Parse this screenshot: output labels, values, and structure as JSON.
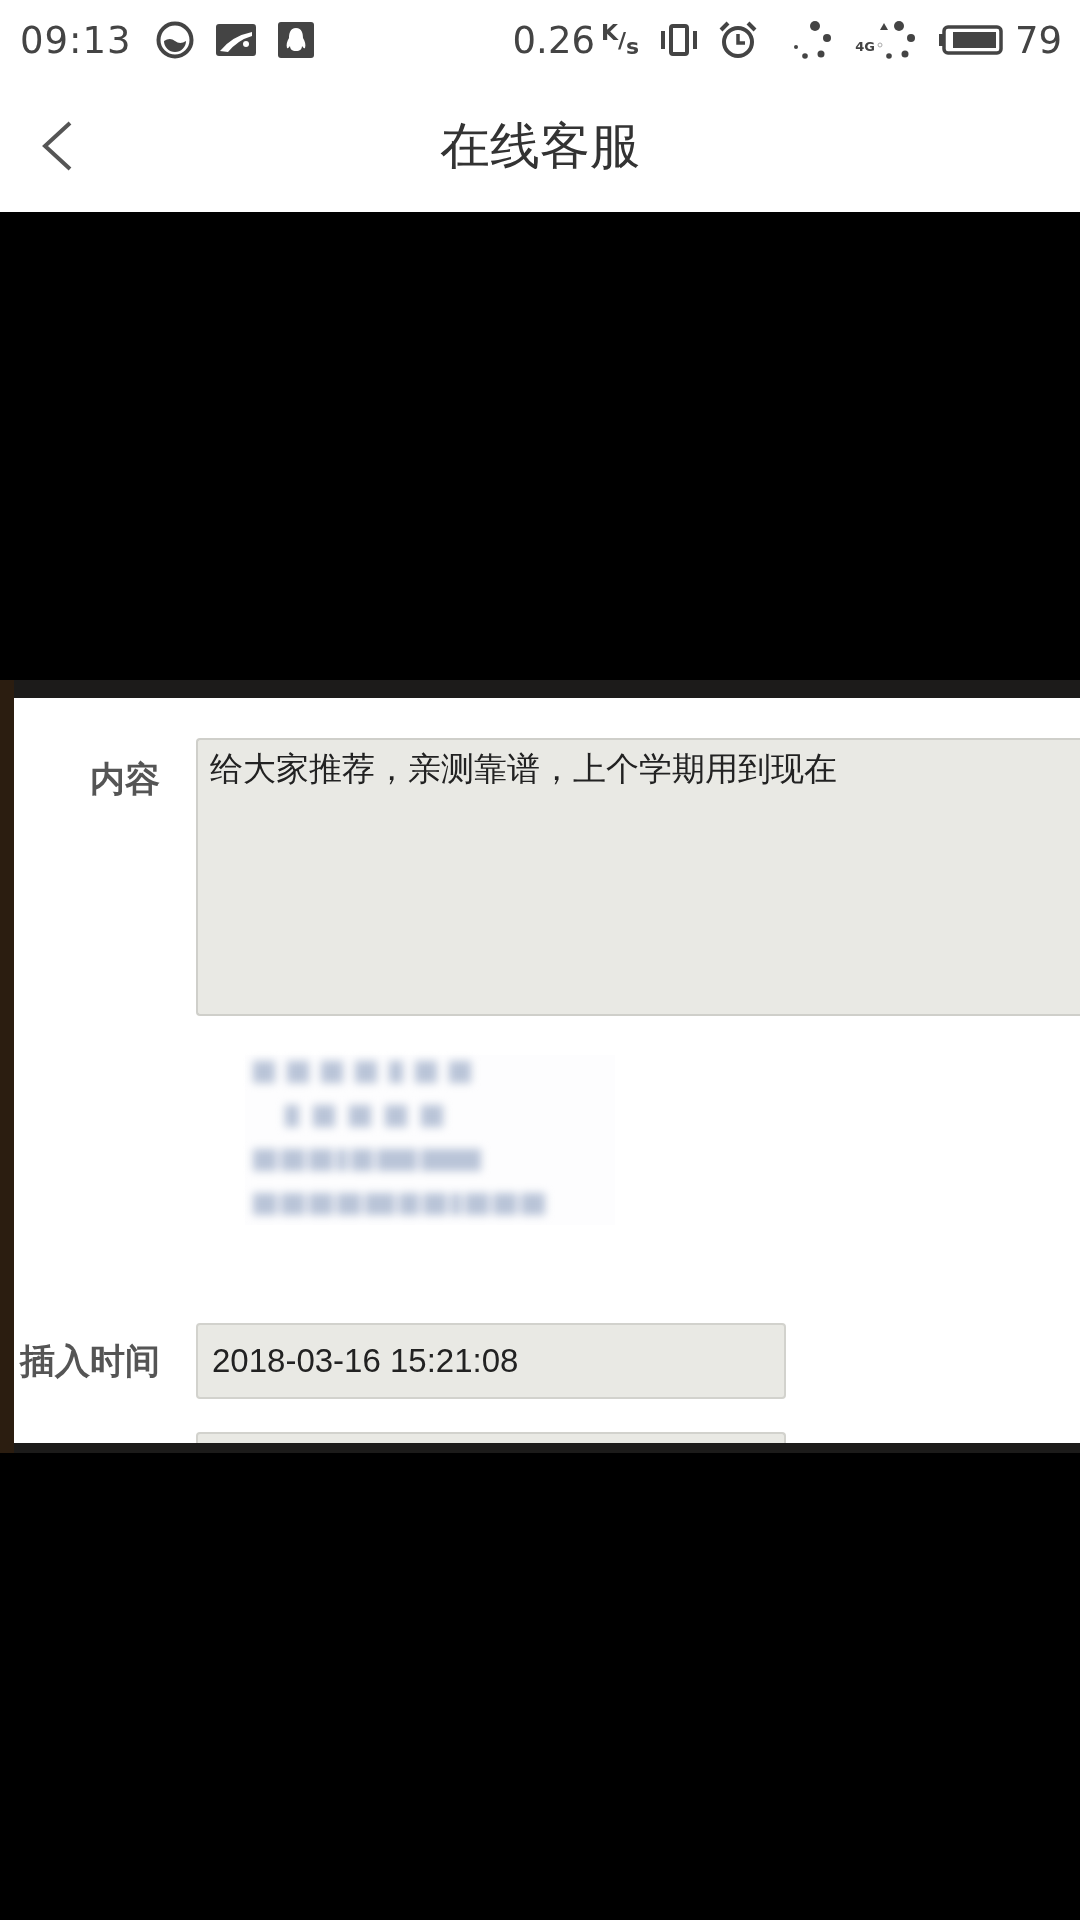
{
  "status_bar": {
    "time": "09:13",
    "net_speed": "0.26",
    "net_speed_unit": "$^{K}$/$_{s}$",
    "network_type": "4G",
    "battery": "79"
  },
  "header": {
    "title": "在线客服"
  },
  "screenshot": {
    "fields": [
      {
        "kind": "textarea",
        "label": "内容",
        "value": "给大家推荐，亲测靠谱，上个学期用到现在"
      },
      {
        "kind": "image"
      },
      {
        "kind": "input",
        "label": "插入时间",
        "value": "2018-03-16 15:21:08"
      },
      {
        "kind": "stub"
      }
    ]
  }
}
